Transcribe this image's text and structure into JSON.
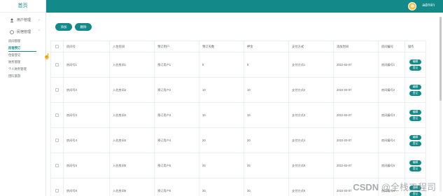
{
  "sidebar": {
    "home": "首页",
    "groups": [
      {
        "label": "用户管理"
      },
      {
        "label": "民宿管理",
        "items": [
          "房间管理",
          "民宿预订",
          "住宿登记",
          "财务管理",
          "个人财务管理",
          "团队旅游"
        ]
      }
    ],
    "active_item": "民宿预订"
  },
  "header": {
    "username": "admin"
  },
  "toolbar": {
    "add_label": "添加",
    "delete_label": "删除"
  },
  "table": {
    "columns": [
      "房间号",
      "入住房间",
      "预订用户",
      "预订天数",
      "押金",
      "支付方式",
      "添加时间",
      "房间编号",
      "操作"
    ],
    "rows": [
      [
        "房间号1",
        "入住房间1",
        "预订用户1",
        "5",
        "5",
        "支付方式1",
        "2022-03-07",
        "房间编号1"
      ],
      [
        "房间号2",
        "入住房间2",
        "预订用户2",
        "10",
        "10",
        "支付方式2",
        "2022-03-07",
        "房间编号2"
      ],
      [
        "房间号3",
        "入住房间3",
        "预订用户3",
        "15",
        "15",
        "支付方式3",
        "2022-03-07",
        "房间编号3"
      ],
      [
        "房间号4",
        "入住房间4",
        "预订用户4",
        "20",
        "20",
        "支付方式4",
        "2022-03-07",
        "房间编号4"
      ],
      [
        "房间号5",
        "入住房间5",
        "预订用户5",
        "25",
        "25",
        "支付方式5",
        "2022-03-07",
        "房间编号5"
      ],
      [
        "房间号6",
        "入住房间6",
        "预订用户6",
        "30",
        "30",
        "支付方式6",
        "2022-03-07",
        "房间编号6"
      ]
    ],
    "row_actions": [
      "编辑",
      "登记"
    ]
  },
  "watermark": {
    "brand": "CSDN",
    "author": "@全栈工程司"
  },
  "colors": {
    "accent": "#13898a",
    "header": "#13898a",
    "avatar": "#f1c14a"
  }
}
